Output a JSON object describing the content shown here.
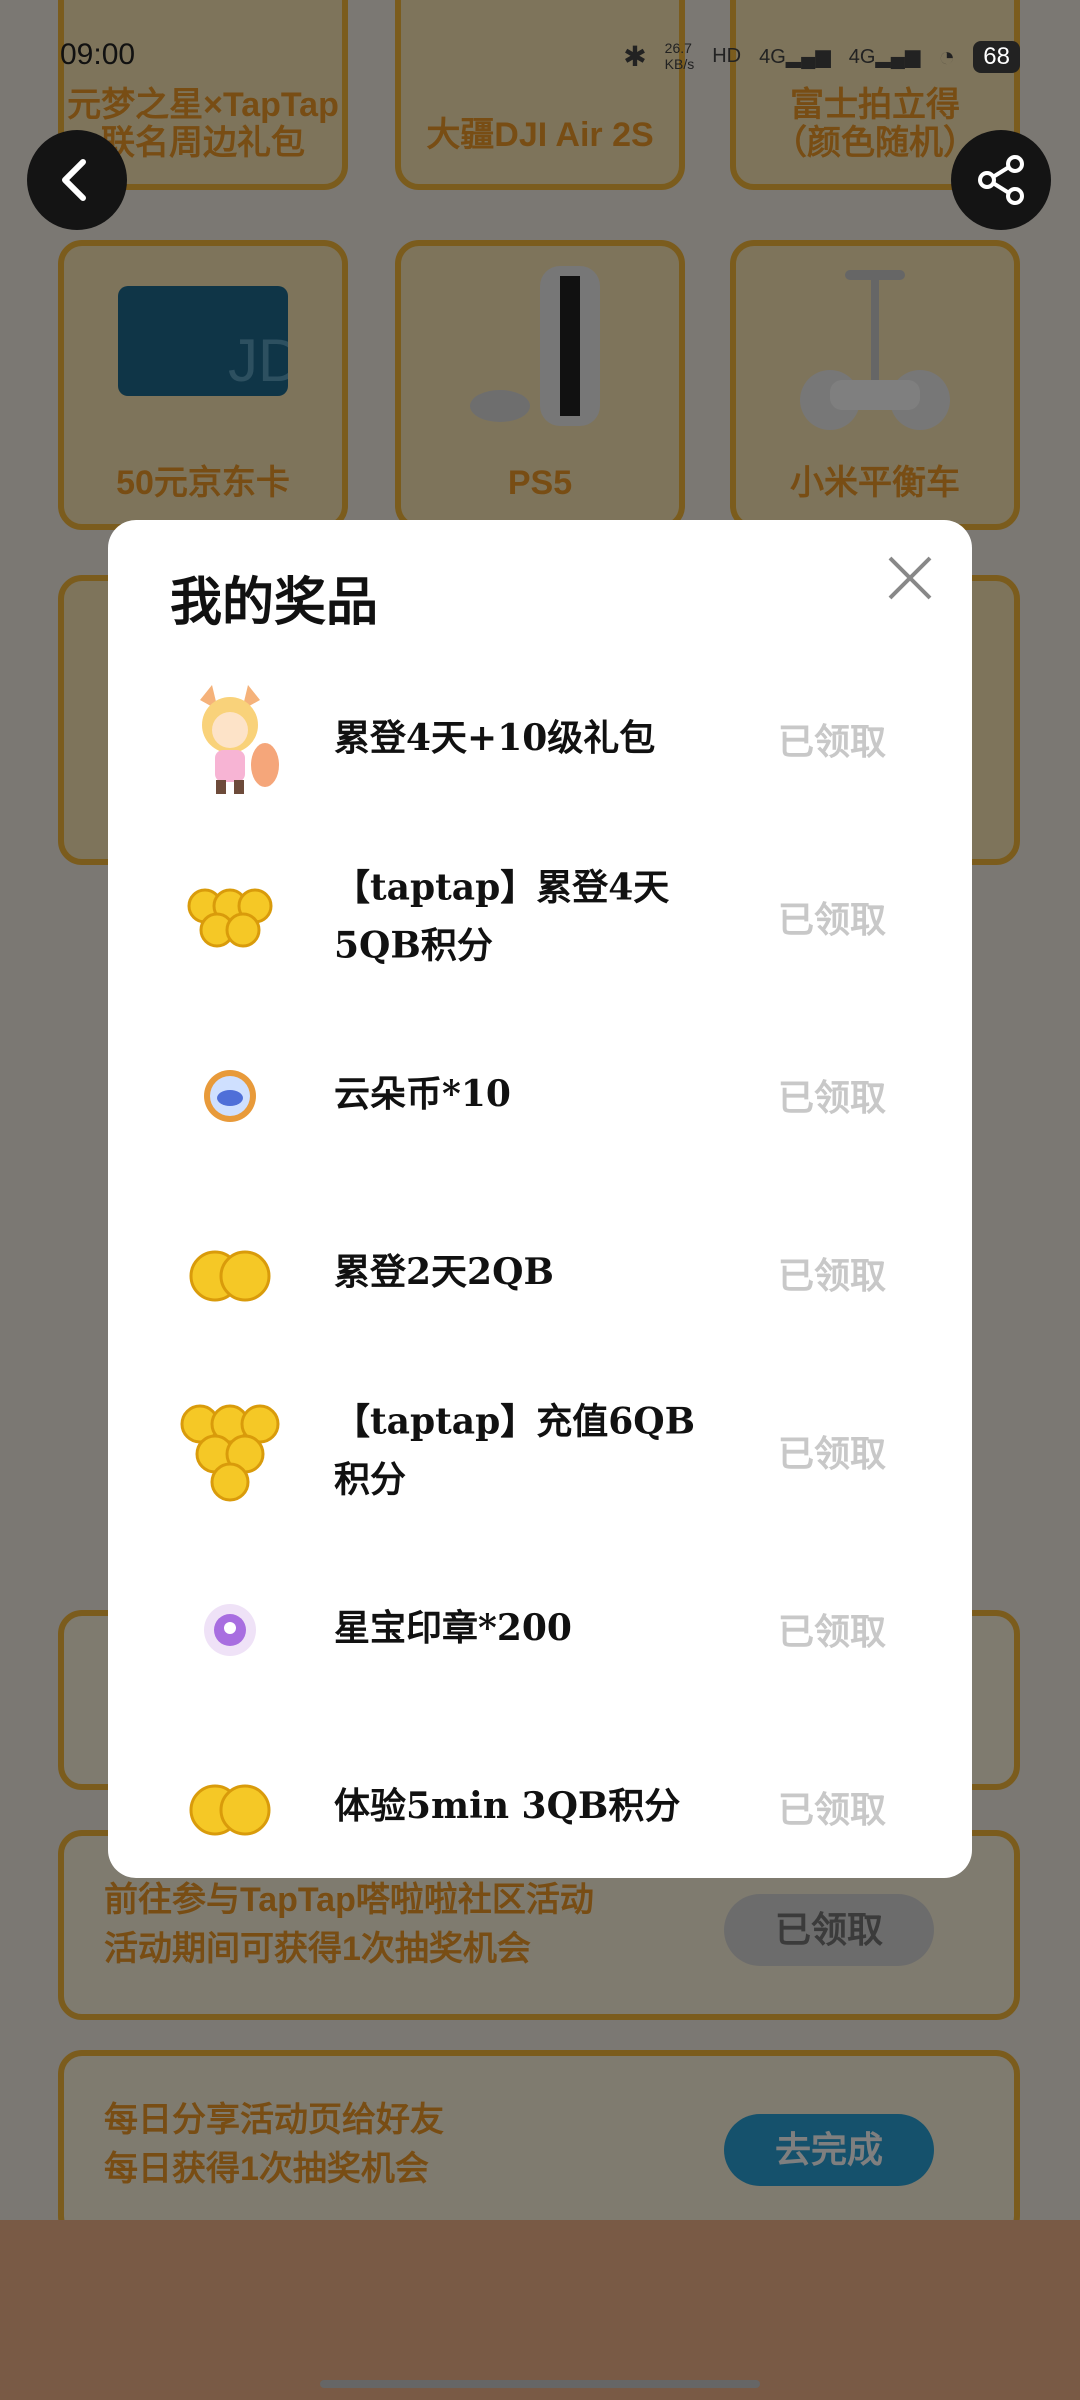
{
  "status_bar": {
    "time": "09:00",
    "net_speed": "26.7\nKB/s",
    "battery": "68"
  },
  "background": {
    "cards": [
      {
        "title": "元梦之星×TapTap\n联名周边礼包"
      },
      {
        "title": "大疆DJI Air 2S"
      },
      {
        "title": "富士拍立得\n（颜色随机）"
      },
      {
        "title": "50元京东卡"
      },
      {
        "title": "PS5"
      },
      {
        "title": "小米平衡车"
      }
    ],
    "tasks": [
      {
        "text": "前往参与TapTap嗒啦啦社区活动\n活动期间可获得1次抽奖机会",
        "button": "已领取"
      },
      {
        "text": "每日分享活动页给好友\n每日获得1次抽奖机会",
        "button": "去完成"
      }
    ]
  },
  "modal": {
    "title": "我的奖品",
    "items": [
      {
        "name": "累登4天+10级礼包",
        "status": "已领取",
        "icon": "character-icon"
      },
      {
        "name": "【taptap】累登4天5QB积分",
        "status": "已领取",
        "icon": "coins-6-icon"
      },
      {
        "name": "云朵币*10",
        "status": "已领取",
        "icon": "cloud-coin-icon"
      },
      {
        "name": "累登2天2QB",
        "status": "已领取",
        "icon": "coins-2-icon"
      },
      {
        "name": "【taptap】充值6QB积分",
        "status": "已领取",
        "icon": "coins-6-icon"
      },
      {
        "name": "星宝印章*200",
        "status": "已领取",
        "icon": "star-stamp-icon"
      },
      {
        "name": "体验5min 3QB积分",
        "status": "已领取",
        "icon": "coins-3-icon"
      }
    ]
  },
  "colors": {
    "accent": "#f7b93a",
    "accent_text": "#f19a28",
    "claimed_text": "#c8c8c8"
  }
}
